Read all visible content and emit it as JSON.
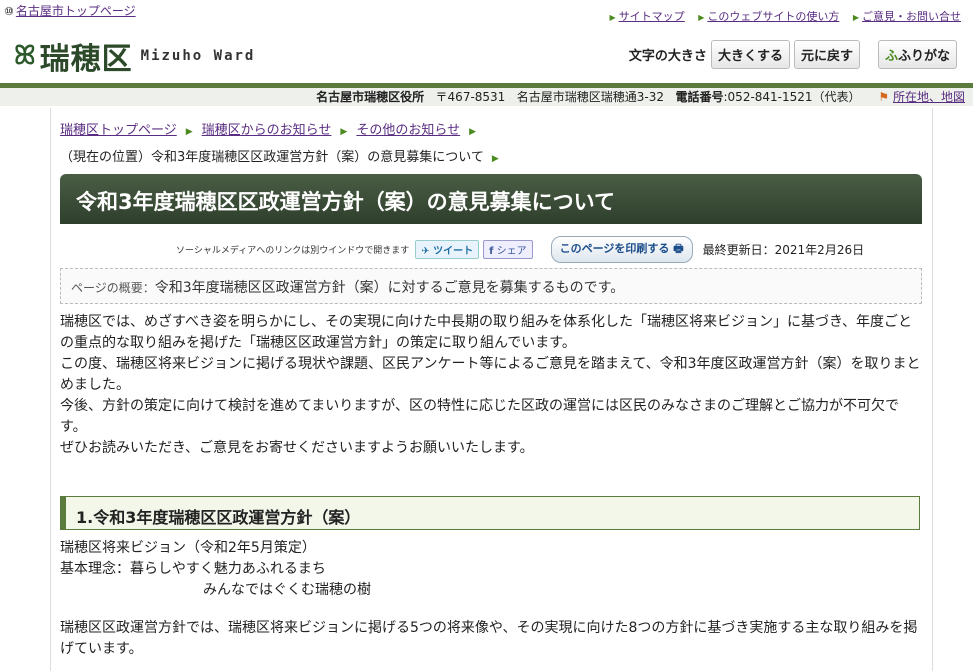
{
  "header": {
    "top_link_prefix": "⑩",
    "top_link": "名古屋市トップページ",
    "util_links": [
      "サイトマップ",
      "このウェブサイトの使い方",
      "ご意見・お問い合せ"
    ],
    "logo_mark": "ꕤ",
    "logo_jp": "瑞穂区",
    "logo_en": "Mizuho Ward",
    "font_size_label": "文字の大きさ",
    "font_bigger": "大きくする",
    "font_reset": "元に戻す",
    "furigana_icon": "ふ",
    "furigana": "ふりがな"
  },
  "address": {
    "office": "名古屋市瑞穂区役所",
    "postal": "〒467-8531",
    "street": "名古屋市瑞穂区瑞穂通3-32",
    "phone_label": "電話番号",
    "phone": ":052-841-1521（代表）",
    "map_link": "所在地、地図"
  },
  "breadcrumb": {
    "items": [
      "瑞穂区トップページ",
      "瑞穂区からのお知らせ",
      "その他のお知らせ"
    ],
    "current": "（現在の位置）令和3年度瑞穂区区政運営方針（案）の意見募集について"
  },
  "page": {
    "title": "令和3年度瑞穂区区政運営方針（案）の意見募集について",
    "social_note": "ソーシャルメディアへのリンクは別ウインドウで開きます",
    "tweet": "ツイート",
    "share": "シェア",
    "print": "このページを印刷する",
    "updated": "最終更新日：2021年2月26日",
    "summary_label": "ページの概要：",
    "summary": "令和3年度瑞穂区区政運営方針（案）に対するご意見を募集するものです。",
    "paragraphs": [
      "瑞穂区では、めざすべき姿を明らかにし、その実現に向けた中長期の取り組みを体系化した「瑞穂区将来ビジョン」に基づき、年度ごとの重点的な取り組みを掲げた「瑞穂区区政運営方針」の策定に取り組んでいます。",
      "この度、瑞穂区将来ビジョンに掲げる現状や課題、区民アンケート等によるご意見を踏まえて、令和3年度区政運営方針（案）を取りまとめました。",
      "今後、方針の策定に向けて検討を進めてまいりますが、区の特性に応じた区政の運営には区民のみなさまのご理解とご協力が不可欠です。",
      "ぜひお読みいただき、ご意見をお寄せくださいますようお願いいたします。"
    ],
    "section_heading": "1.令和3年度瑞穂区区政運営方針（案）",
    "vision_line": "瑞穂区将来ビジョン（令和2年5月策定）",
    "principle_line1": "基本理念：暮らしやすく魅力あふれるまち",
    "principle_line2": "みんなではぐくむ瑞穂の樹",
    "section_para": "瑞穂区区政運営方針では、瑞穂区将来ビジョンに掲げる5つの将来像や、その実現に向けた8つの方針に基づき実施する主な取り組みを掲げています。"
  }
}
